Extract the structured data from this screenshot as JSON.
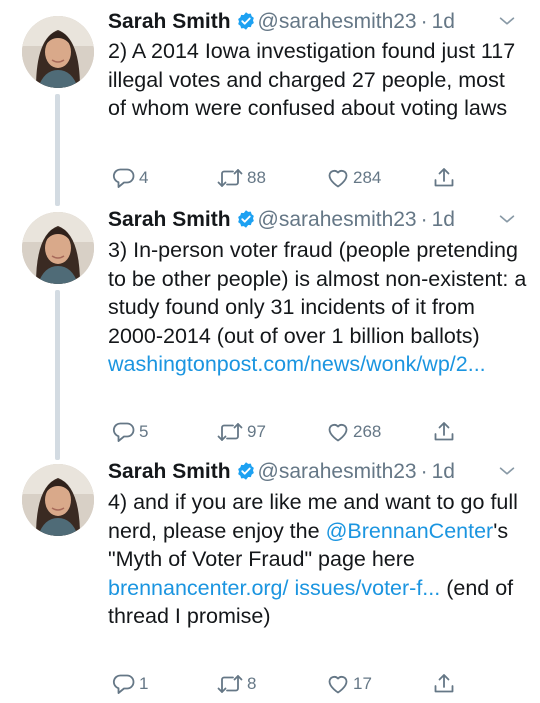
{
  "tweets": [
    {
      "name": "Sarah Smith",
      "handle": "@sarahesmith23",
      "time": "1d",
      "text": "2) A 2014 Iowa investigation found just 117 illegal votes and charged 27 people, most of whom were confused about voting laws",
      "replies": "4",
      "retweets": "88",
      "likes": "284"
    },
    {
      "name": "Sarah Smith",
      "handle": "@sarahesmith23",
      "time": "1d",
      "text": "3) In-person voter fraud (people pretending to be other people) is almost non-existent: a study found only 31 incidents of it from 2000-2014 (out of over 1 billion ballots)",
      "link": "washingtonpost.com/news/wonk/wp/2...",
      "replies": "5",
      "retweets": "97",
      "likes": "268"
    },
    {
      "name": "Sarah Smith",
      "handle": "@sarahesmith23",
      "time": "1d",
      "text_a": "4) and if you are like me and want to go full nerd, please enjoy the",
      "mention": "@BrennanCenter",
      "text_b": "'s \"Myth of Voter Fraud\" page here",
      "link": "brennancenter.org/ issues/voter-f...",
      "text_c": "(end of thread I promise)",
      "replies": "1",
      "retweets": "8",
      "likes": "17"
    }
  ],
  "icons": {
    "verified": "verified-badge-icon",
    "caret": "chevron-down-icon",
    "reply": "reply-icon",
    "retweet": "retweet-icon",
    "like": "heart-icon",
    "share": "share-icon"
  },
  "colors": {
    "link": "#1b95e0",
    "secondary": "#657786",
    "thread_line": "#d3dbe2",
    "verified": "#1da1f2"
  }
}
